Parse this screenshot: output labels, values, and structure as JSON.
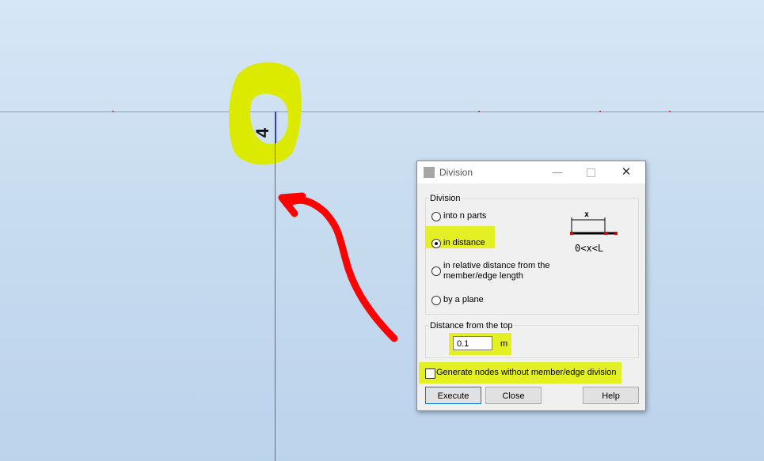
{
  "viewport": {
    "member_label": "4"
  },
  "dialog": {
    "title": "Division",
    "minimize_glyph": "—",
    "close_glyph": "✕",
    "division_group": {
      "label": "Division",
      "options": [
        {
          "label": "into n parts",
          "selected": false
        },
        {
          "label": "in distance",
          "selected": true
        },
        {
          "label_line1": "in relative distance from the",
          "label_line2": "member/edge length",
          "selected": false
        },
        {
          "label": "by a plane",
          "selected": false
        }
      ],
      "diagram": {
        "x_label": "x",
        "range_label": "0<x<L"
      }
    },
    "distance_group": {
      "label": "Distance from the top",
      "value": "0.1",
      "unit": "m"
    },
    "generate_nodes": {
      "label": "Generate nodes without member/edge division",
      "checked": false
    },
    "buttons": {
      "execute": "Execute",
      "close": "Close",
      "help": "Help"
    }
  },
  "colors": {
    "highlight": "#e3f000",
    "annotation_arrow": "#ff0000",
    "background": "#c8dcef"
  }
}
